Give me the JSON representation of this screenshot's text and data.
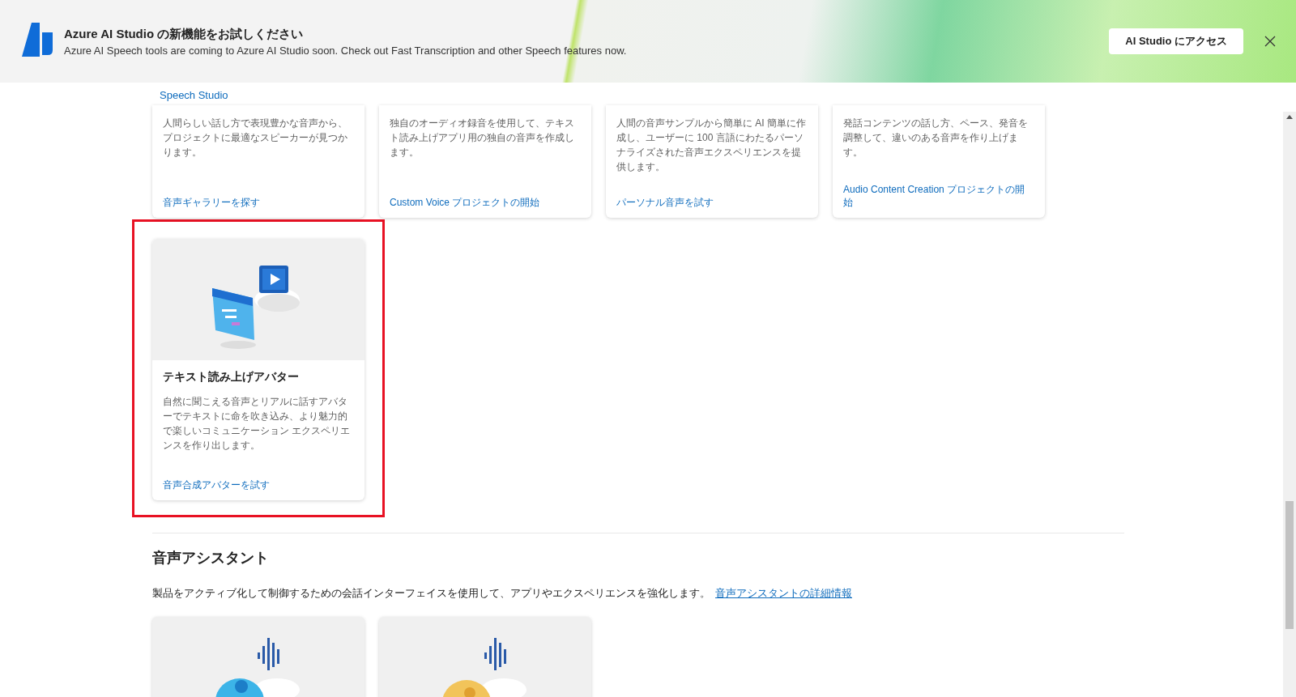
{
  "banner": {
    "title": "Azure AI Studio の新機能をお試しください",
    "message": "Azure AI Speech tools are coming to Azure AI Studio soon. Check out Fast Transcription and other Speech features now.",
    "button": "AI Studio にアクセス"
  },
  "breadcrumb": "Speech Studio",
  "voice_cards": [
    {
      "kind": "clipped",
      "highlighted": false,
      "description": "人間らしい話し方で表現豊かな音声から、プロジェクトに最適なスピーカーが見つかります。",
      "link": "音声ギャラリーを探す"
    },
    {
      "kind": "clipped",
      "highlighted": false,
      "description": "独自のオーディオ録音を使用して、テキスト読み上げアプリ用の独自の音声を作成します。",
      "link": "Custom Voice プロジェクトの開始"
    },
    {
      "kind": "clipped",
      "highlighted": false,
      "description": "人間の音声サンプルから簡単に AI 簡単に作成し、ユーザーに 100 言語にわたるパーソナライズされた音声エクスペリエンスを提供します。",
      "link": "パーソナル音声を試す"
    },
    {
      "kind": "clipped",
      "highlighted": false,
      "description": "発話コンテンツの話し方、ペース、発音を調整して、違いのある音声を作り上げます。",
      "link": "Audio Content Creation プロジェクトの開始"
    },
    {
      "kind": "full",
      "highlighted": true,
      "title": "テキスト読み上げアバター",
      "description": "自然に聞こえる音声とリアルに話すアバターでテキストに命を吹き込み、より魅力的で楽しいコミュニケーション エクスペリエンスを作り出します。",
      "link": "音声合成アバターを試す"
    }
  ],
  "assistant": {
    "heading": "音声アシスタント",
    "description": "製品をアクティブ化して制御するための会話インターフェイスを使用して、アプリやエクスペリエンスを強化します。",
    "link": "音声アシスタントの詳細情報",
    "cards": [
      {
        "kind": "bot"
      },
      {
        "kind": "speaker"
      }
    ]
  }
}
